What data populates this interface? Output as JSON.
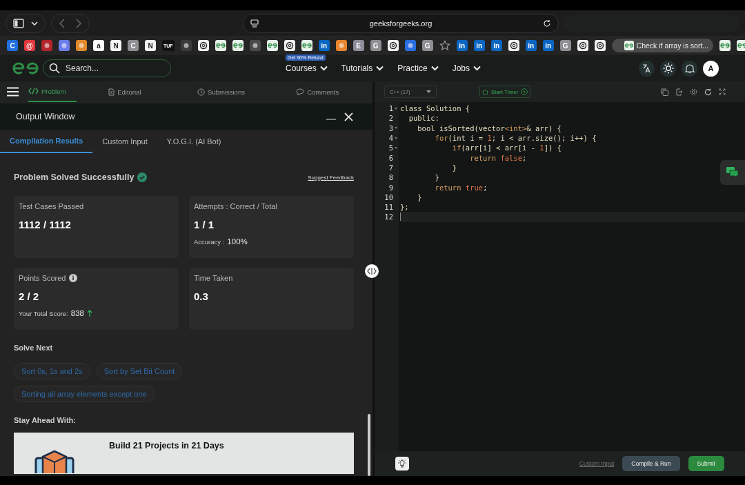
{
  "browser": {
    "url": "geeksforgeeks.org",
    "bookmarks": [
      {
        "kind": "letter",
        "glyph": "C",
        "color": "#1f6fe0"
      },
      {
        "kind": "letter",
        "glyph": "@",
        "color": "#e0383e"
      },
      {
        "kind": "logo",
        "color": "#b3262b"
      },
      {
        "kind": "logo",
        "color": "#6b7de8"
      },
      {
        "kind": "logo",
        "color": "#e08a2c"
      },
      {
        "kind": "letter",
        "glyph": "a",
        "color": "#ffffff"
      },
      {
        "kind": "letter",
        "glyph": "N",
        "color": "#f4f4f4"
      },
      {
        "kind": "letter",
        "glyph": "C",
        "color": "#8e8e93"
      },
      {
        "kind": "letter",
        "glyph": "N",
        "color": "#f4f4f4"
      },
      {
        "kind": "letter",
        "glyph": "TUF",
        "color": "#111111"
      },
      {
        "kind": "logo",
        "color": "#3a3a3a"
      },
      {
        "kind": "openai",
        "color": "#f2f2f2"
      },
      {
        "kind": "gfg",
        "color": "#e8f3ea"
      },
      {
        "kind": "gfg",
        "color": "#e8f3ea"
      },
      {
        "kind": "logo",
        "color": "#4a4a4a"
      },
      {
        "kind": "gfg",
        "color": "#e8f3ea"
      },
      {
        "kind": "openai",
        "color": "#f2f2f2"
      },
      {
        "kind": "gfg",
        "color": "#e8f3ea"
      },
      {
        "kind": "letter",
        "glyph": "in",
        "color": "#0a66c2"
      },
      {
        "kind": "logo",
        "color": "#e8842c"
      },
      {
        "kind": "letter",
        "glyph": "E",
        "color": "#8e8e9a"
      },
      {
        "kind": "letter",
        "glyph": "G",
        "color": "#8e8e93"
      },
      {
        "kind": "openai",
        "color": "#f2f2f2"
      },
      {
        "kind": "logo",
        "color": "#2a6de0"
      },
      {
        "kind": "letter",
        "glyph": "G",
        "color": "#8e8e93"
      },
      {
        "kind": "star"
      },
      {
        "kind": "letter",
        "glyph": "in",
        "color": "#0a66c2"
      },
      {
        "kind": "letter",
        "glyph": "in",
        "color": "#0a66c2"
      },
      {
        "kind": "letter",
        "glyph": "in",
        "color": "#0a66c2"
      },
      {
        "kind": "openai",
        "color": "#f2f2f2"
      },
      {
        "kind": "letter",
        "glyph": "in",
        "color": "#0a66c2"
      },
      {
        "kind": "letter",
        "glyph": "in",
        "color": "#0a66c2"
      },
      {
        "kind": "letter",
        "glyph": "G",
        "color": "#8e8e93"
      },
      {
        "kind": "openai",
        "color": "#f2f2f2"
      },
      {
        "kind": "openai",
        "color": "#f2f2f2"
      }
    ],
    "active_tab": {
      "title": "Check if array is sort..."
    },
    "bookmarks_after": [
      {
        "kind": "gfg",
        "color": "#e8f3ea"
      },
      {
        "kind": "gfg",
        "color": "#e8f3ea"
      }
    ]
  },
  "header": {
    "search": {
      "placeholder": "Search..."
    },
    "nav": [
      {
        "label": "Courses",
        "badge": "Get 90% Refund"
      },
      {
        "label": "Tutorials"
      },
      {
        "label": "Practice"
      },
      {
        "label": "Jobs"
      }
    ],
    "avatar": "A"
  },
  "problem_tabs": [
    {
      "label": "Problem",
      "kind": "code",
      "selected": true
    },
    {
      "label": "Editorial",
      "kind": "document",
      "selected": false
    },
    {
      "label": "Submissions",
      "kind": "clock",
      "selected": false
    },
    {
      "label": "Comments",
      "kind": "comment",
      "selected": false
    }
  ],
  "output_window": {
    "title": "Output Window",
    "tabs": [
      {
        "label": "Compilation Results",
        "selected": true
      },
      {
        "label": "Custom Input",
        "selected": false
      },
      {
        "label": "Y.O.G.I. (AI Bot)",
        "selected": false
      }
    ],
    "status": "Problem Solved Successfully",
    "feedback_link": "Suggest Feedback",
    "cards": [
      {
        "label": "Test Cases Passed",
        "value": "1112 / 1112"
      },
      {
        "label": "Attempts : Correct / Total",
        "value": "1 / 1",
        "note_label": "Accuracy :",
        "note_value": "100%"
      },
      {
        "label": "Points Scored",
        "info": true,
        "value": "2 / 2",
        "note_label": "Your Total Score:",
        "note_value": "838",
        "trend_up": true
      },
      {
        "label": "Time Taken",
        "value": "0.3"
      }
    ],
    "solve_next": {
      "title": "Solve Next",
      "items": [
        "Sort 0s, 1s and 2s",
        "Sort by Set Bit Count",
        "Sorting all array elements except one"
      ]
    },
    "stay_ahead": {
      "title": "Stay Ahead With:",
      "promo_title": "Build 21 Projects in 21 Days"
    }
  },
  "editor": {
    "language": "C++ (17)",
    "timer": "Start Timer",
    "lines": [
      {
        "number": "1",
        "foldable": true,
        "segments": [
          {
            "text": "class Solution {",
            "kind": "plain"
          }
        ]
      },
      {
        "number": "2",
        "foldable": false,
        "segments": [
          {
            "text": "  public:",
            "kind": "plain"
          }
        ]
      },
      {
        "number": "3",
        "foldable": true,
        "segments": [
          {
            "text": "    bool isSorted(vector",
            "kind": "plain"
          },
          {
            "text": "<int>",
            "kind": "keyword"
          },
          {
            "text": "& arr) {",
            "kind": "plain"
          }
        ]
      },
      {
        "number": "4",
        "foldable": true,
        "segments": [
          {
            "text": "        for",
            "kind": "keyword"
          },
          {
            "text": "(int i = ",
            "kind": "plain"
          },
          {
            "text": "1",
            "kind": "literal"
          },
          {
            "text": "; i < arr.size(); i++) {",
            "kind": "plain"
          }
        ]
      },
      {
        "number": "5",
        "foldable": true,
        "segments": [
          {
            "text": "            if",
            "kind": "keyword"
          },
          {
            "text": "(arr[i] < arr[i - ",
            "kind": "plain"
          },
          {
            "text": "1",
            "kind": "literal"
          },
          {
            "text": "]) {",
            "kind": "plain"
          }
        ]
      },
      {
        "number": "6",
        "foldable": false,
        "segments": [
          {
            "text": "                return",
            "kind": "keyword"
          },
          {
            "text": " false",
            "kind": "literal"
          },
          {
            "text": ";",
            "kind": "plain"
          }
        ]
      },
      {
        "number": "7",
        "foldable": false,
        "segments": [
          {
            "text": "            }",
            "kind": "plain"
          }
        ]
      },
      {
        "number": "8",
        "foldable": false,
        "segments": [
          {
            "text": "        }",
            "kind": "plain"
          }
        ]
      },
      {
        "number": "9",
        "foldable": false,
        "segments": [
          {
            "text": "        return",
            "kind": "keyword"
          },
          {
            "text": " true",
            "kind": "literal"
          },
          {
            "text": ";",
            "kind": "plain"
          }
        ]
      },
      {
        "number": "10",
        "foldable": false,
        "segments": [
          {
            "text": "    }",
            "kind": "plain"
          }
        ]
      },
      {
        "number": "11",
        "foldable": false,
        "segments": [
          {
            "text": "};",
            "kind": "plain"
          }
        ]
      },
      {
        "number": "12",
        "foldable": false,
        "current": true
      }
    ],
    "custom_input_link": "Custom Input",
    "buttons": [
      {
        "label": "Compile & Run",
        "kind": "secondary"
      },
      {
        "label": "Submit",
        "kind": "primary"
      }
    ]
  }
}
